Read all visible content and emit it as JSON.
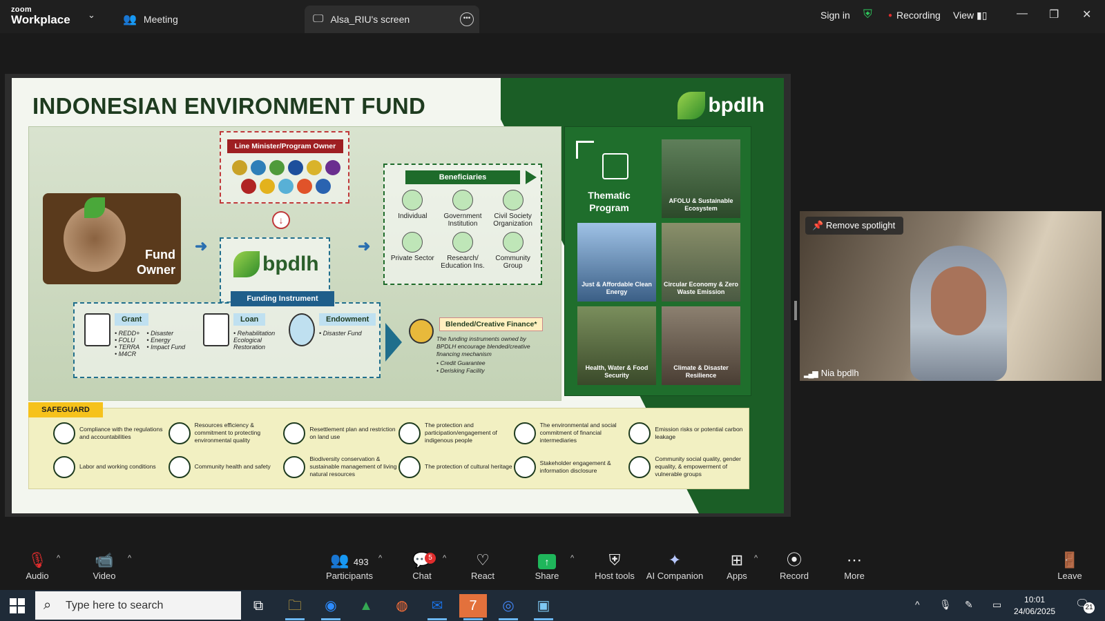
{
  "app": {
    "brand_top": "zoom",
    "brand_bottom": "Workplace"
  },
  "tabs": [
    {
      "label": "Meeting",
      "icon": "people-icon"
    },
    {
      "label": "Alsa_RIU's screen",
      "icon": "screen-share-icon"
    }
  ],
  "header_right": {
    "sign_in": "Sign in",
    "recording": "Recording",
    "view": "View"
  },
  "colors": {
    "accent_green": "#1fb65b",
    "slide_green": "#1b5e26",
    "recording_red": "#e02d2d",
    "taskbar": "#1f2b38"
  },
  "slide": {
    "title": "INDONESIAN ENVIRONMENT FUND",
    "brand": "bpdlh",
    "fund_owner": "Fund\nOwner",
    "line_minister": "Line Minister/Program Owner",
    "funding_instrument": "Funding Instrument",
    "instruments": [
      {
        "name": "Grant",
        "icon_label": "GRANT",
        "col1": "• REDD+\n• FOLU\n• TERRA\n• M4CR",
        "col2": "• Disaster\n• Energy\n• Impact Fund"
      },
      {
        "name": "Loan",
        "icon_label": "LOAN",
        "col1": "• Rehabilitation\n  Ecological\n  Restoration",
        "col2": ""
      },
      {
        "name": "Endowment",
        "icon_label": "",
        "col1": "• Disaster Fund",
        "col2": ""
      }
    ],
    "blended": {
      "name": "Blended/Creative Finance*",
      "text": "The funding instruments owned by BPDLH encourage blended/creative financing mechanism",
      "bullets": "• Credit Guarantee\n• Derisking Facility"
    },
    "beneficiaries": {
      "title": "Beneficiaries",
      "items": [
        "Individual",
        "Government Institution",
        "Civil Society Organization",
        "Private Sector",
        "Research/ Education Ins.",
        "Community Group"
      ]
    },
    "thematic": {
      "title": "Thematic Program",
      "tiles": [
        "AFOLU & Sustainable Ecosystem",
        "Just & Affordable Clean Energy",
        "Circular Economy & Zero Waste Emission",
        "Health, Water & Food Security",
        "Climate & Disaster Resilience"
      ]
    },
    "safeguard": {
      "title": "SAFEGUARD",
      "items": [
        "Compliance with the regulations and accountabilities",
        "Resources efficiency & commitment to protecting environmental quality",
        "Resettlement plan and restriction on land use",
        "The protection and participation/engagement of indigenous people",
        "The environmental and social commitment of financial intermediaries",
        "Emission risks or potential carbon leakage",
        "Labor and working conditions",
        "Community health and safety",
        "Biodiversity conservation & sustainable management of living natural resources",
        "The protection of cultural heritage",
        "Stakeholder engagement & information disclosure",
        "Community social quality, gender equality, & empowerment of vulnerable groups"
      ]
    }
  },
  "video": {
    "spotlight": "Remove spotlight",
    "name": "Nia bpdlh"
  },
  "toolbar": {
    "audio": "Audio",
    "video": "Video",
    "participants": "Participants",
    "participants_count": "493",
    "chat": "Chat",
    "chat_badge": "5",
    "react": "React",
    "share": "Share",
    "host_tools": "Host tools",
    "ai_companion": "AI Companion",
    "apps": "Apps",
    "record": "Record",
    "more": "More",
    "leave": "Leave"
  },
  "taskbar": {
    "search_placeholder": "Type here to search",
    "time": "10:01",
    "date": "24/06/2025",
    "notifications": "21",
    "teams_badge": "7"
  }
}
